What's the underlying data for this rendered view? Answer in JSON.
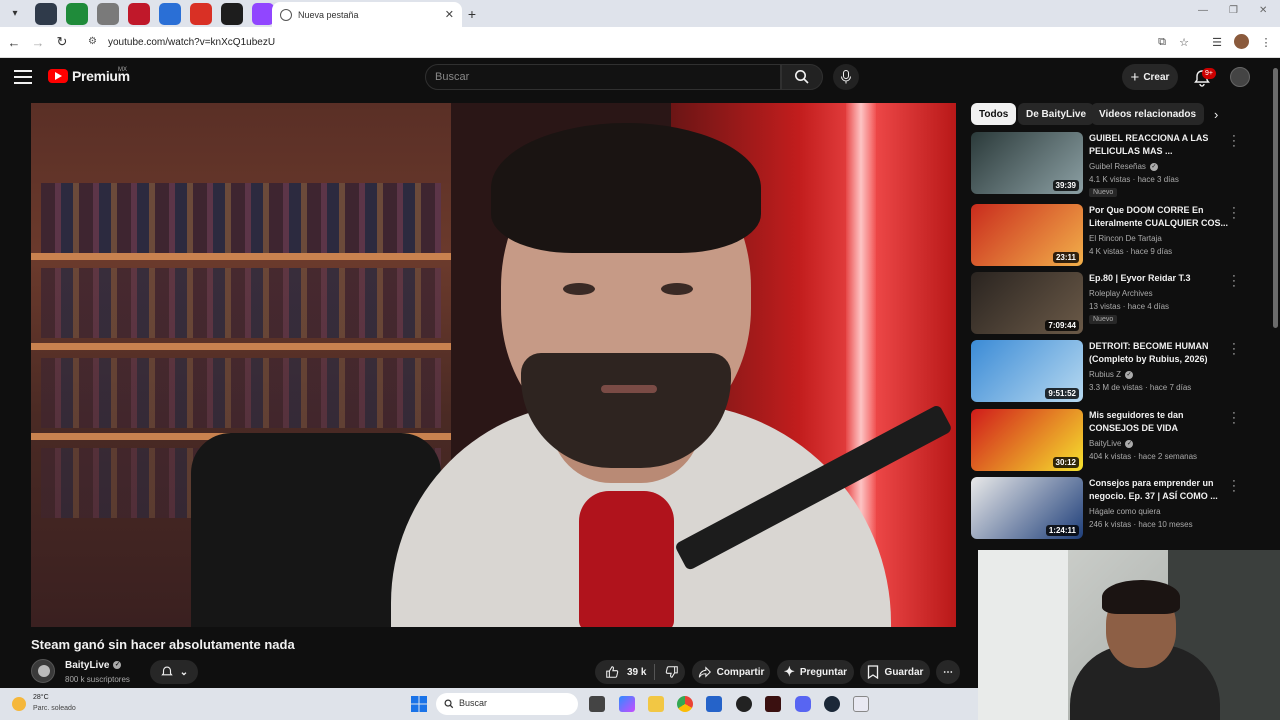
{
  "browser": {
    "pinned_tabs": [
      {
        "icon": "save-icon",
        "color": "#2f3a4a"
      },
      {
        "icon": "extension-icon",
        "color": "#1f8b3a"
      },
      {
        "icon": "document-icon",
        "color": "#7a7a7a"
      },
      {
        "icon": "red-app-icon",
        "color": "#c0182a"
      },
      {
        "icon": "globe-icon",
        "color": "#2a6fd6"
      },
      {
        "icon": "gmail-icon",
        "color": "#d93025"
      },
      {
        "icon": "kick-icon",
        "color": "#1d1d1d"
      },
      {
        "icon": "twitch-icon",
        "color": "#9146ff"
      },
      {
        "icon": "audio-icon",
        "color": "#444444"
      }
    ],
    "active_tab_title": "Nueva pestaña",
    "url": "youtube.com/watch?v=knXcQ1ubezU"
  },
  "header": {
    "logo_text": "Premium",
    "region": "MX",
    "search_placeholder": "Buscar",
    "create_label": "Crear",
    "notifications_badge": "9+"
  },
  "video": {
    "title": "Steam ganó sin hacer absolutamente nada",
    "channel": "BaityLive",
    "subscribers": "800 k suscriptores",
    "likes": "39 k",
    "share_label": "Compartir",
    "ask_label": "Preguntar",
    "save_label": "Guardar"
  },
  "sidebar": {
    "chips": [
      "Todos",
      "De BaityLive",
      "Videos relacionados"
    ],
    "recommendations": [
      {
        "title": "GUIBEL REACCIONA A LAS PELICULAS MAS ...",
        "channel": "Guibel Reseñas",
        "verified": true,
        "stats": "4.1 K vistas · hace 3 días",
        "duration": "39:39",
        "badge": "Nuevo",
        "thumb_colors": [
          "#2b3a3a",
          "#8ca0a4"
        ]
      },
      {
        "title": "Por Que DOOM CORRE En Literalmente CUALQUIER COS...",
        "channel": "El Rincon De Tartaja",
        "verified": false,
        "stats": "4 K vistas · hace 9 días",
        "duration": "23:11",
        "badge": "",
        "thumb_colors": [
          "#c92b1d",
          "#f2b04a"
        ]
      },
      {
        "title": "Ep.80 | Eyvor Reidar T.3",
        "channel": "Roleplay Archives",
        "verified": false,
        "stats": "13 vistas · hace 4 días",
        "duration": "7:09:44",
        "badge": "Nuevo",
        "thumb_colors": [
          "#2a2420",
          "#6b5a48"
        ]
      },
      {
        "title": "DETROIT: BECOME HUMAN (Completo by Rubius, 2026)",
        "channel": "Rubius Z",
        "verified": true,
        "stats": "3.3 M de vistas · hace 7 días",
        "duration": "9:51:52",
        "badge": "",
        "thumb_colors": [
          "#3b8bd6",
          "#b7d9f0"
        ]
      },
      {
        "title": "Mis seguidores te dan CONSEJOS DE VIDA",
        "channel": "BaityLive",
        "verified": true,
        "stats": "404 k vistas · hace 2 semanas",
        "duration": "30:12",
        "badge": "",
        "thumb_colors": [
          "#d01b1b",
          "#f6e22e"
        ]
      },
      {
        "title": "Consejos para emprender un negocio. Ep. 37 | ASÍ COMO ...",
        "channel": "Hágale como quiera",
        "verified": false,
        "stats": "246 k vistas · hace 10 meses",
        "duration": "1:24:11",
        "badge": "",
        "thumb_colors": [
          "#e9e9e9",
          "#1f3f7a"
        ]
      }
    ]
  },
  "taskbar": {
    "temperature": "28°C",
    "condition": "Parc. soleado",
    "search_placeholder": "Buscar"
  }
}
